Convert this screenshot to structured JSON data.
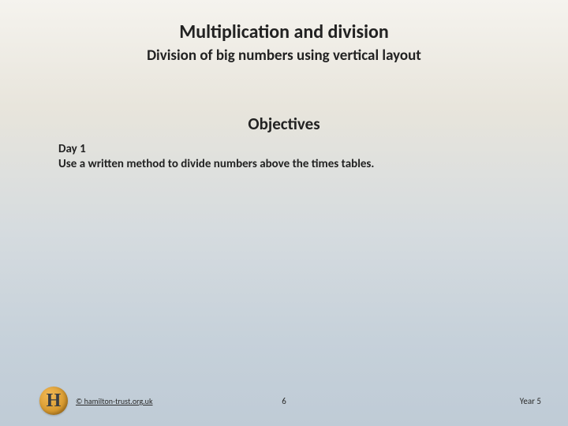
{
  "header": {
    "title": "Multiplication and division",
    "subtitle": "Division of big numbers using vertical layout"
  },
  "section": {
    "heading": "Objectives"
  },
  "body": {
    "day_label": "Day 1",
    "objective": "Use a written method to divide numbers above the times tables."
  },
  "footer": {
    "logo_letter": "H",
    "copyright": "© hamilton-trust.org.uk",
    "page_number": "6",
    "year_label": "Year 5"
  }
}
